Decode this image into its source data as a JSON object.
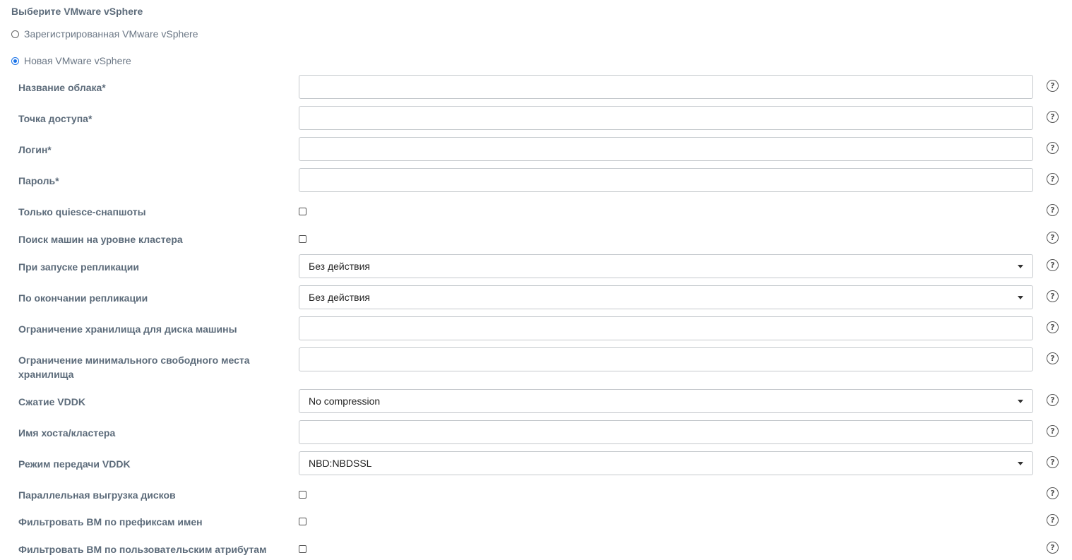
{
  "section_title": "Выберите VMware vSphere",
  "radios": {
    "registered": "Зарегистрированная VMware vSphere",
    "new": "Новая VMware vSphere"
  },
  "help_symbol": "?",
  "fields": {
    "cloud_name": {
      "label": "Название облака*",
      "value": ""
    },
    "access_point": {
      "label": "Точка доступа*",
      "value": ""
    },
    "login": {
      "label": "Логин*",
      "value": ""
    },
    "password": {
      "label": "Пароль*",
      "value": ""
    },
    "quiesce_only": {
      "label": "Только quiesce-снапшоты",
      "checked": false
    },
    "cluster_search": {
      "label": "Поиск машин на уровне кластера",
      "checked": false
    },
    "on_replication_start": {
      "label": "При запуске репликации",
      "selected": "Без действия"
    },
    "on_replication_end": {
      "label": "По окончании репликации",
      "selected": "Без действия"
    },
    "storage_limit": {
      "label": "Ограничение хранилища для диска машины",
      "value": ""
    },
    "min_free_space": {
      "label": "Ограничение минимального свободного места хранилища",
      "value": ""
    },
    "vddk_compression": {
      "label": "Сжатие VDDK",
      "selected": "No compression"
    },
    "host_cluster_name": {
      "label": "Имя хоста/кластера",
      "value": ""
    },
    "vddk_transfer_mode": {
      "label": "Режим передачи VDDK",
      "selected": "NBD:NBDSSL"
    },
    "parallel_disk_export": {
      "label": "Параллельная выгрузка дисков",
      "checked": false
    },
    "filter_by_prefix": {
      "label": "Фильтровать ВМ по префиксам имен",
      "checked": false
    },
    "filter_by_attributes": {
      "label": "Фильтровать ВМ по пользовательским атрибутам",
      "checked": false
    }
  }
}
